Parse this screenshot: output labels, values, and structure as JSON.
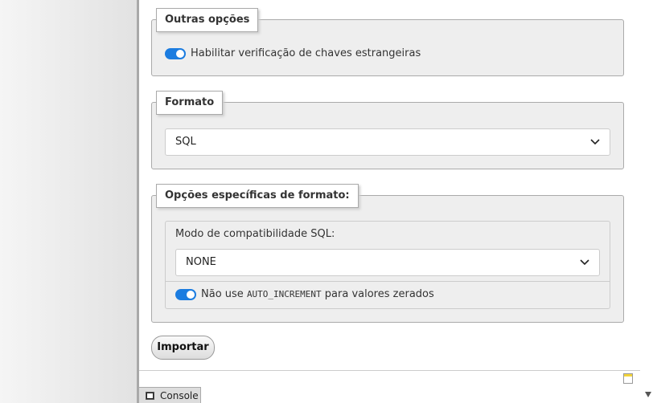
{
  "other_options": {
    "legend": "Outras opções",
    "fk_check_label": "Habilitar verificação de chaves estrangeiras",
    "fk_check_enabled": true
  },
  "format": {
    "legend": "Formato",
    "selected": "SQL"
  },
  "format_specific": {
    "legend": "Opções específicas de formato:",
    "compat_label": "Modo de compatibilidade SQL:",
    "compat_selected": "NONE",
    "auto_inc_prefix": "Não use",
    "auto_inc_code": "AUTO_INCREMENT",
    "auto_inc_suffix": "para valores zerados",
    "auto_inc_enabled": true
  },
  "import_button": "Importar",
  "console_tab": "Console",
  "accent_color": "#1b7ce0"
}
